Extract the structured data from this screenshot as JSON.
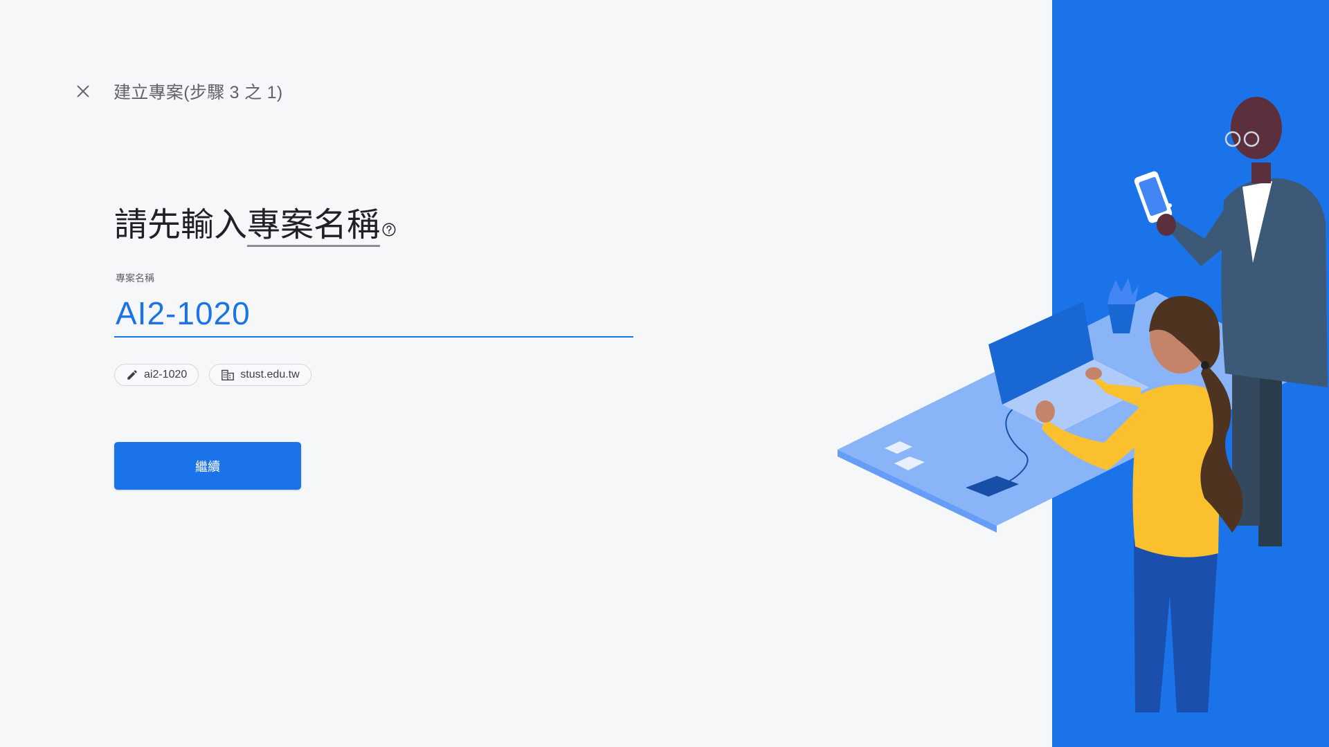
{
  "header": {
    "step_title": "建立專案(步驟 3 之 1)",
    "close_icon": "close-icon"
  },
  "heading": {
    "prefix": "請先輸入",
    "term": "專案名稱",
    "help_icon": "help-circle-icon"
  },
  "project_name_field": {
    "label": "專案名稱",
    "value": "AI2-1020"
  },
  "chips": [
    {
      "icon": "pencil-icon",
      "label": "ai2-1020"
    },
    {
      "icon": "organization-icon",
      "label": "stust.edu.tw"
    }
  ],
  "continue_button": {
    "label": "繼續"
  },
  "colors": {
    "accent": "#1a73e8",
    "background": "#f5f7f8",
    "panel": "#1a73e8"
  }
}
